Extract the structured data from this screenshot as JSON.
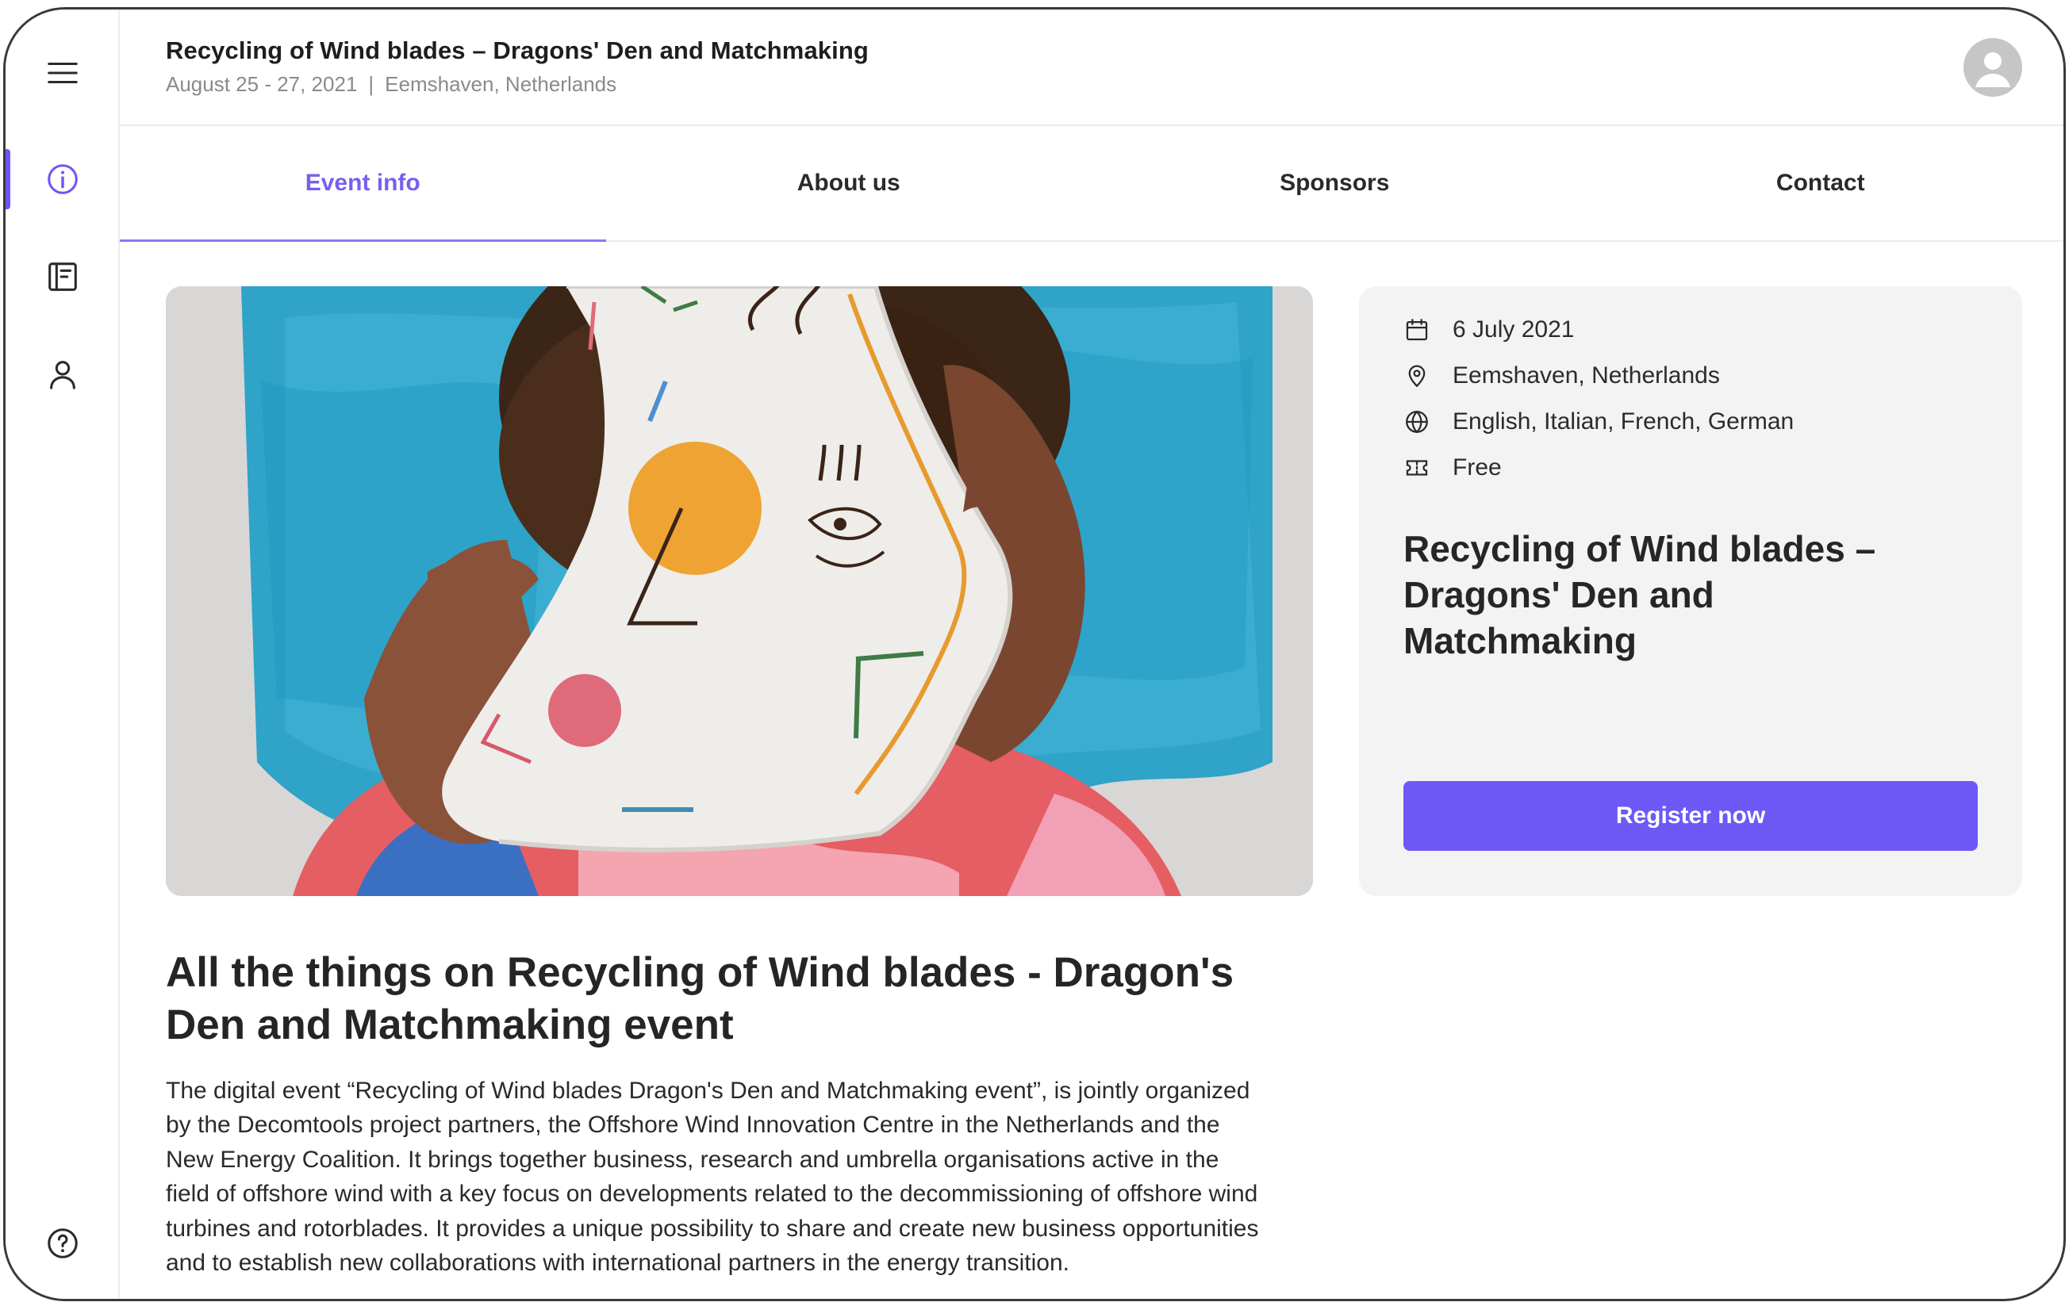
{
  "header": {
    "title": "Recycling of Wind blades – Dragons' Den and Matchmaking",
    "dates": "August 25 - 27, 2021",
    "separator": "|",
    "location": "Eemshaven, Netherlands"
  },
  "tabs": [
    {
      "label": "Event info"
    },
    {
      "label": "About us"
    },
    {
      "label": "Sponsors"
    },
    {
      "label": "Contact"
    }
  ],
  "sidebar": {
    "items": [
      {
        "icon": "info-icon"
      },
      {
        "icon": "notebook-icon"
      },
      {
        "icon": "user-icon"
      },
      {
        "icon": "help-icon"
      }
    ]
  },
  "card": {
    "date": "6 July 2021",
    "location": "Eemshaven, Netherlands",
    "languages": "English, Italian, French, German",
    "price": "Free",
    "title": "Recycling of Wind blades – Dragons' Den and Matchmaking",
    "register_label": "Register now"
  },
  "article": {
    "title": "All the things on Recycling of Wind blades - Dragon's Den and Matchmaking event",
    "body": "The digital event “Recycling of Wind blades Dragon's Den and Matchmaking event”, is jointly organized by the Decomtools project partners, the Offshore Wind Innovation Centre in the Netherlands and the New Energy Coalition. It brings together business, research and umbrella organisations active in the field of offshore wind with a key focus on developments related to the decommissioning of offshore wind turbines and rotorblades. It provides a unique possibility to share and create new business opportunities and to establish new collaborations with international partners in the energy transition."
  },
  "colors": {
    "accent": "#6e58f6",
    "active_tab": "#7660f0",
    "card_bg": "#f3f3f4"
  }
}
